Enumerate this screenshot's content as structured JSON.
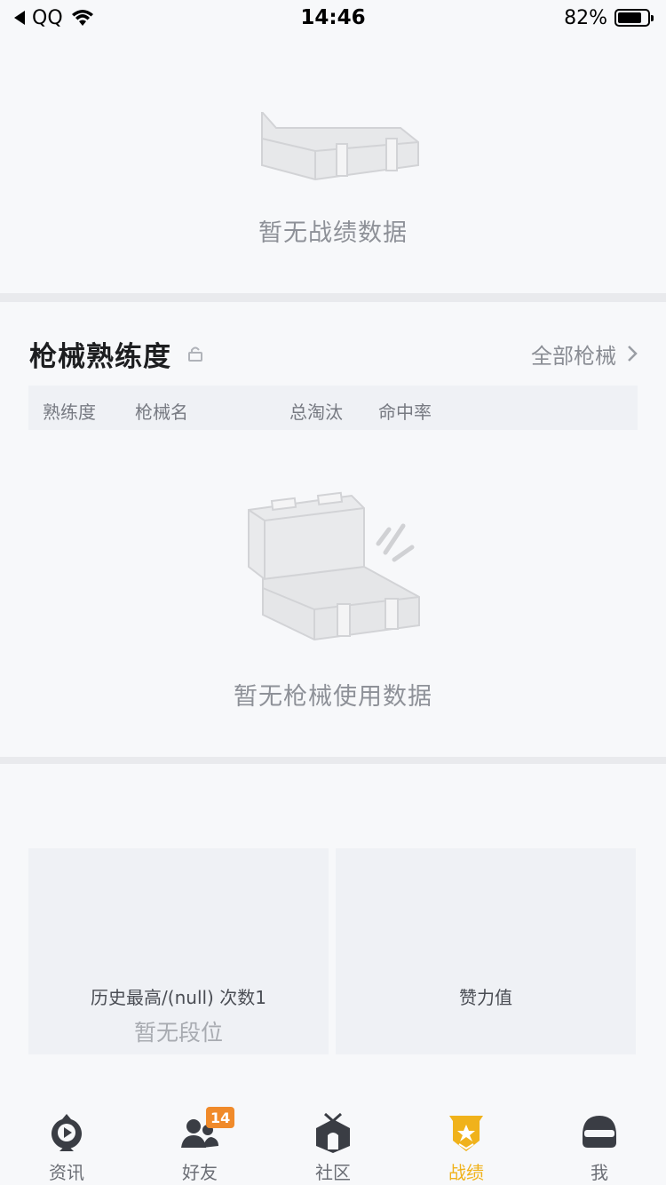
{
  "status_bar": {
    "carrier": "QQ",
    "time": "14:46",
    "battery_percent": "82%",
    "battery_level": 0.82
  },
  "summary": {
    "empty_text": "暂无战绩数据"
  },
  "weapon_mastery": {
    "title": "枪械熟练度",
    "all_link": "全部枪械",
    "columns": [
      "熟练度",
      "枪械名",
      "总淘汰",
      "命中率"
    ],
    "empty_text": "暂无枪械使用数据"
  },
  "rank_cards": {
    "left_line1": "历史最高/(null) 次数1",
    "left_line2": "暂无段位",
    "right_line1": "赞力值"
  },
  "tabs": [
    {
      "label": "资讯",
      "icon": "news-play-icon",
      "active": false
    },
    {
      "label": "好友",
      "icon": "friends-icon",
      "active": false,
      "badge": "14"
    },
    {
      "label": "社区",
      "icon": "community-icon",
      "active": false
    },
    {
      "label": "战绩",
      "icon": "record-badge-icon",
      "active": true
    },
    {
      "label": "我",
      "icon": "helmet-icon",
      "active": false
    }
  ],
  "colors": {
    "accent": "#f0b21b",
    "badge": "#f08a2a"
  }
}
